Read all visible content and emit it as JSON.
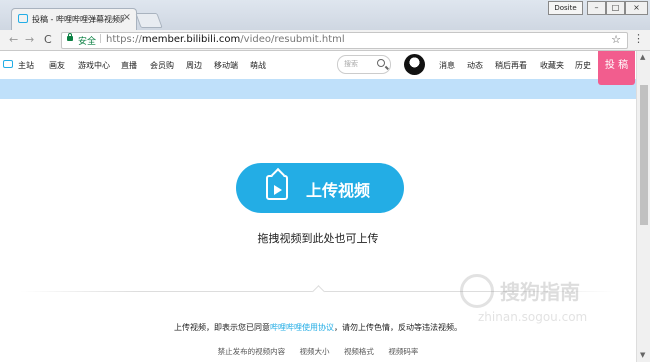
{
  "browser": {
    "tab_title": "投稿 - 哔哩哔哩弹幕视频网",
    "tab_close": "×",
    "profile_label": "Dosite",
    "win_min": "–",
    "win_max": "□",
    "win_close": "×",
    "back": "←",
    "forward": "→",
    "reload": "C",
    "secure_label": "安全",
    "url_separator": "|",
    "url_scheme": "https://",
    "url_host": "member.bilibili.com",
    "url_path": "/video/resubmit.html",
    "bookmark_star": "☆",
    "menu": "⋮"
  },
  "site_nav": {
    "items": [
      "主站",
      "画友",
      "游戏中心",
      "直播",
      "会员购",
      "周边",
      "移动端",
      "萌战"
    ],
    "search_placeholder": "搜索",
    "right_items": [
      "消息",
      "动态",
      "稍后再看",
      "收藏夹",
      "历史"
    ],
    "upload_button": "投 稿"
  },
  "upload": {
    "button_label": "上传视频",
    "drag_tip": "拖拽视频到此处也可上传",
    "agree_prefix": "上传视频，即表示您已同意",
    "agree_link": "哔哩哔哩使用协议",
    "agree_suffix": "，请勿上传色情，反动等违法视频。",
    "bottom_links": [
      "禁止发布的视频内容",
      "视频大小",
      "视频格式",
      "视频码率"
    ]
  },
  "watermark": {
    "text": "搜狗指南",
    "sub": "zhinan.sogou.com"
  },
  "colors": {
    "accent": "#23ade5",
    "upload_pink": "#f25d8e",
    "banner": "#bfe0fa",
    "secure_green": "#0b8043"
  }
}
